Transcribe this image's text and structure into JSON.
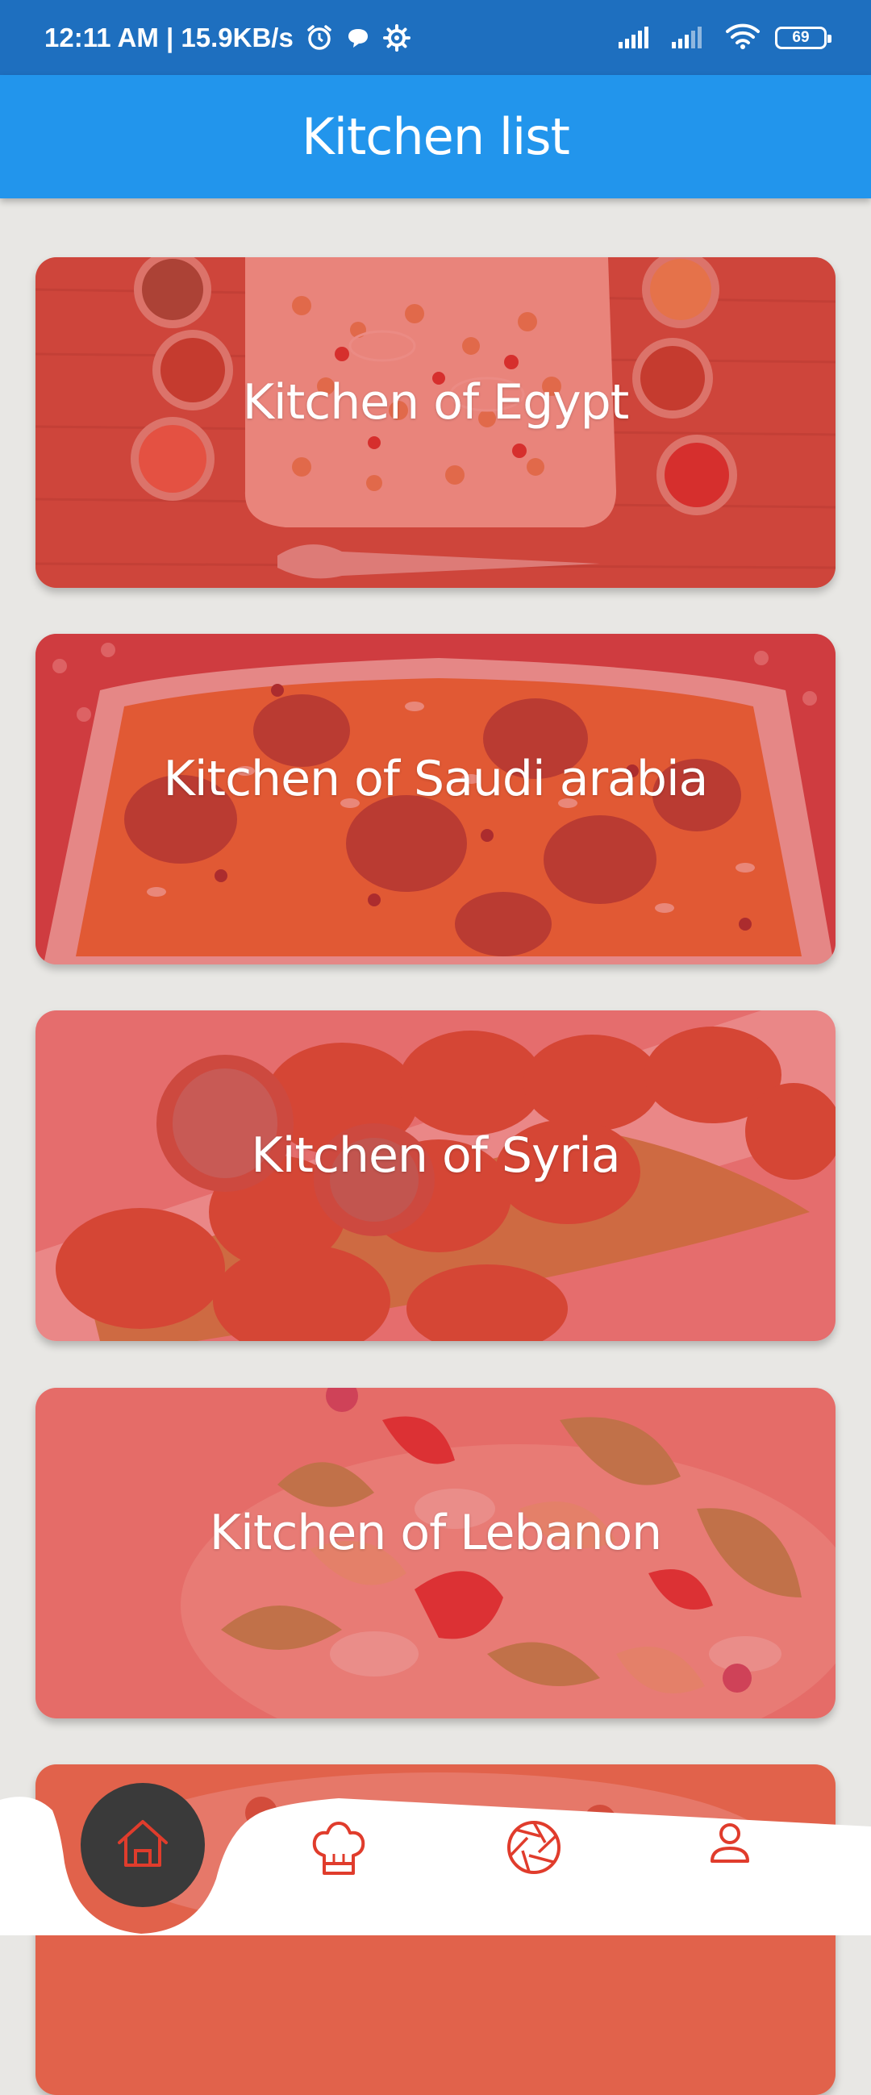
{
  "status_bar": {
    "time_speed": "12:11 AM | 15.9KB/s",
    "icons": [
      "alarm-icon",
      "chat-bubble-icon",
      "settings-gear-icon",
      "signal-icon",
      "signal-icon",
      "wifi-icon",
      "battery-icon"
    ],
    "battery": "69"
  },
  "app_bar": {
    "title": "Kitchen list",
    "color": "#2295ec"
  },
  "kitchens": [
    {
      "label": "Kitchen of Egypt"
    },
    {
      "label": "Kitchen of Saudi arabia"
    },
    {
      "label": "Kitchen of Syria"
    },
    {
      "label": "Kitchen of Lebanon"
    }
  ],
  "bottom_nav": {
    "items": [
      {
        "icon": "home-icon",
        "active": true
      },
      {
        "icon": "chef-hat-icon",
        "active": false
      },
      {
        "icon": "aperture-icon",
        "active": false
      },
      {
        "icon": "user-icon",
        "active": false
      }
    ],
    "accent_color": "#e03c2c",
    "active_bg": "#3a3a3a"
  }
}
